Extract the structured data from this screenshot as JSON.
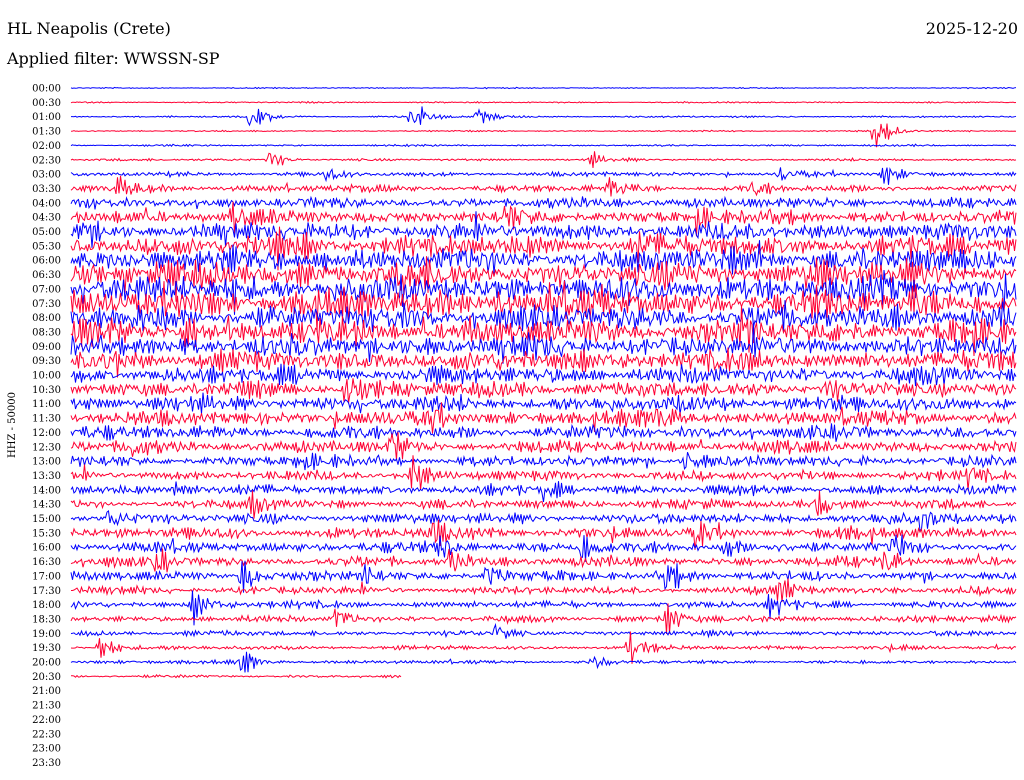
{
  "header": {
    "station": "HL Neapolis (Crete)",
    "date": "2025-12-20",
    "filter": "Applied filter: WWSSN-SP"
  },
  "chart_data": {
    "type": "line",
    "title": "HL Neapolis (Crete)",
    "ylabel": "HHZ - 50000",
    "date": "2025-12-20",
    "filter": "WWSSN-SP",
    "row_labels": [
      "00:00",
      "00:30",
      "01:00",
      "01:30",
      "02:00",
      "02:30",
      "03:00",
      "03:30",
      "04:00",
      "04:30",
      "05:00",
      "05:30",
      "06:00",
      "06:30",
      "07:00",
      "07:30",
      "08:00",
      "08:30",
      "09:00",
      "09:30",
      "10:00",
      "10:30",
      "11:00",
      "11:30",
      "12:00",
      "12:30",
      "13:00",
      "13:30",
      "14:00",
      "14:30",
      "15:00",
      "15:30",
      "16:00",
      "16:30",
      "17:00",
      "17:30",
      "18:00",
      "18:30",
      "19:00",
      "19:30",
      "20:00",
      "20:30",
      "21:00",
      "21:30",
      "22:00",
      "22:30",
      "23:00",
      "23:30"
    ],
    "colors": [
      "#0000ff",
      "#ff0033"
    ],
    "recorded_rows": 42,
    "last_row_fraction": 0.35,
    "noise_level": [
      0.03,
      0.04,
      0.05,
      0.04,
      0.05,
      0.07,
      0.12,
      0.2,
      0.3,
      0.38,
      0.5,
      0.6,
      0.7,
      0.75,
      0.78,
      0.78,
      0.72,
      0.7,
      0.62,
      0.58,
      0.5,
      0.45,
      0.45,
      0.42,
      0.4,
      0.35,
      0.3,
      0.28,
      0.28,
      0.26,
      0.3,
      0.32,
      0.3,
      0.28,
      0.26,
      0.22,
      0.2,
      0.18,
      0.15,
      0.12,
      0.1,
      0.08
    ],
    "events": [
      {
        "row": 2,
        "x": 0.19,
        "amp": 1.1
      },
      {
        "row": 2,
        "x": 0.36,
        "amp": 1.3
      },
      {
        "row": 2,
        "x": 0.43,
        "amp": 0.6
      },
      {
        "row": 3,
        "x": 0.85,
        "amp": 1.6
      },
      {
        "row": 5,
        "x": 0.21,
        "amp": 0.8
      },
      {
        "row": 5,
        "x": 0.55,
        "amp": 0.5
      },
      {
        "row": 6,
        "x": 0.27,
        "amp": 0.6
      },
      {
        "row": 6,
        "x": 0.75,
        "amp": 0.6
      },
      {
        "row": 6,
        "x": 0.86,
        "amp": 0.9
      },
      {
        "row": 7,
        "x": 0.05,
        "amp": 0.7
      },
      {
        "row": 7,
        "x": 0.57,
        "amp": 0.7
      },
      {
        "row": 7,
        "x": 0.72,
        "amp": 0.6
      },
      {
        "row": 9,
        "x": 0.17,
        "amp": 0.9
      },
      {
        "row": 9,
        "x": 0.46,
        "amp": 0.9
      },
      {
        "row": 9,
        "x": 0.66,
        "amp": 0.8
      },
      {
        "row": 11,
        "x": 0.22,
        "amp": 0.9
      },
      {
        "row": 11,
        "x": 0.6,
        "amp": 0.8
      },
      {
        "row": 13,
        "x": 0.35,
        "amp": 1.0
      },
      {
        "row": 13,
        "x": 0.78,
        "amp": 0.9
      },
      {
        "row": 15,
        "x": 0.45,
        "amp": 0.9
      },
      {
        "row": 15,
        "x": 0.89,
        "amp": 1.0
      },
      {
        "row": 17,
        "x": 0.12,
        "amp": 0.8
      },
      {
        "row": 17,
        "x": 0.71,
        "amp": 0.9
      },
      {
        "row": 19,
        "x": 0.04,
        "amp": 0.9
      },
      {
        "row": 19,
        "x": 0.52,
        "amp": 0.8
      },
      {
        "row": 21,
        "x": 0.29,
        "amp": 0.9
      },
      {
        "row": 21,
        "x": 0.8,
        "amp": 0.8
      },
      {
        "row": 23,
        "x": 0.38,
        "amp": 1.0
      },
      {
        "row": 23,
        "x": 0.62,
        "amp": 0.7
      },
      {
        "row": 25,
        "x": 0.06,
        "amp": 0.9
      },
      {
        "row": 25,
        "x": 0.34,
        "amp": 1.1
      },
      {
        "row": 26,
        "x": 0.24,
        "amp": 0.8
      },
      {
        "row": 26,
        "x": 0.65,
        "amp": 0.8
      },
      {
        "row": 27,
        "x": 0.36,
        "amp": 1.3
      },
      {
        "row": 27,
        "x": 0.95,
        "amp": 0.9
      },
      {
        "row": 28,
        "x": 0.11,
        "amp": 0.8
      },
      {
        "row": 28,
        "x": 0.5,
        "amp": 0.8
      },
      {
        "row": 29,
        "x": 0.19,
        "amp": 0.9
      },
      {
        "row": 29,
        "x": 0.79,
        "amp": 0.9
      },
      {
        "row": 30,
        "x": 0.04,
        "amp": 0.8
      },
      {
        "row": 30,
        "x": 0.9,
        "amp": 1.0
      },
      {
        "row": 31,
        "x": 0.38,
        "amp": 1.0
      },
      {
        "row": 31,
        "x": 0.66,
        "amp": 0.9
      },
      {
        "row": 32,
        "x": 0.39,
        "amp": 1.1
      },
      {
        "row": 32,
        "x": 0.54,
        "amp": 1.1
      },
      {
        "row": 32,
        "x": 0.69,
        "amp": 1.0
      },
      {
        "row": 32,
        "x": 0.87,
        "amp": 0.9
      },
      {
        "row": 33,
        "x": 0.09,
        "amp": 0.9
      },
      {
        "row": 33,
        "x": 0.4,
        "amp": 1.0
      },
      {
        "row": 33,
        "x": 0.86,
        "amp": 1.0
      },
      {
        "row": 34,
        "x": 0.18,
        "amp": 1.3
      },
      {
        "row": 34,
        "x": 0.31,
        "amp": 0.9
      },
      {
        "row": 34,
        "x": 0.44,
        "amp": 1.1
      },
      {
        "row": 34,
        "x": 0.63,
        "amp": 1.1
      },
      {
        "row": 35,
        "x": 0.75,
        "amp": 1.0
      },
      {
        "row": 36,
        "x": 0.13,
        "amp": 1.2
      },
      {
        "row": 36,
        "x": 0.74,
        "amp": 1.1
      },
      {
        "row": 37,
        "x": 0.28,
        "amp": 1.0
      },
      {
        "row": 37,
        "x": 0.63,
        "amp": 1.2
      },
      {
        "row": 38,
        "x": 0.45,
        "amp": 0.8
      },
      {
        "row": 39,
        "x": 0.03,
        "amp": 1.1
      },
      {
        "row": 39,
        "x": 0.59,
        "amp": 1.2
      },
      {
        "row": 40,
        "x": 0.18,
        "amp": 0.9
      },
      {
        "row": 40,
        "x": 0.55,
        "amp": 0.5
      }
    ]
  }
}
